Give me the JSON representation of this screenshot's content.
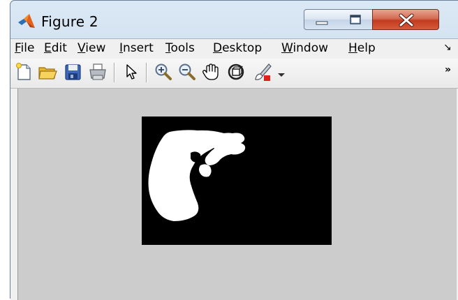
{
  "window": {
    "title": "Figure 2"
  },
  "menubar": {
    "items": [
      {
        "underline": "F",
        "rest": "ile"
      },
      {
        "underline": "E",
        "rest": "dit"
      },
      {
        "underline": "V",
        "rest": "iew"
      },
      {
        "underline": "I",
        "rest": "nsert"
      },
      {
        "underline": "T",
        "rest": "ools"
      },
      {
        "underline": "D",
        "rest": "esktop"
      },
      {
        "underline": "W",
        "rest": "indow"
      },
      {
        "underline": "H",
        "rest": "elp"
      }
    ],
    "overflow": "↘"
  },
  "toolbar": {
    "icons": [
      "new-figure-icon",
      "open-file-icon",
      "save-icon",
      "print-icon",
      "edit-plot-arrow-icon",
      "zoom-in-icon",
      "zoom-out-icon",
      "pan-hand-icon",
      "rotate-3d-icon",
      "data-cursor-brush-icon",
      "dropdown-chevron-icon"
    ],
    "more": "»"
  },
  "colors": {
    "figure_background": "#cccccc",
    "axes_background": "#000000",
    "shape_fill": "#ffffff",
    "close_button": "#c7432a"
  }
}
